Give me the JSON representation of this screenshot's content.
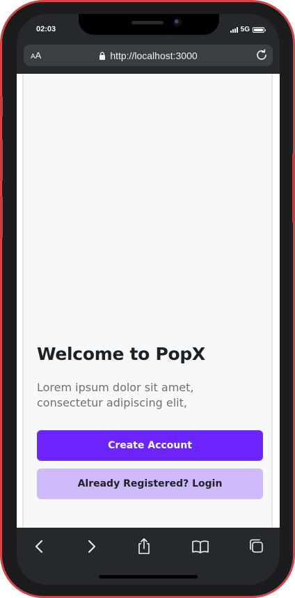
{
  "status_bar": {
    "time": "02:03",
    "network": "5G"
  },
  "browser": {
    "aa_label_small": "A",
    "aa_label_large": "A",
    "url": "http://localhost:3000"
  },
  "page": {
    "title": "Welcome to PopX",
    "subtitle": "Lorem ipsum dolor sit amet, consectetur adipiscing elit,",
    "primary_button": "Create Account",
    "secondary_button": "Already Registered? Login"
  },
  "colors": {
    "primary": "#6c25ff",
    "secondary": "#cebafb",
    "frame": "#d2464a"
  },
  "toolbar_icons": [
    "back-icon",
    "forward-icon",
    "share-icon",
    "bookmarks-icon",
    "tabs-icon"
  ]
}
